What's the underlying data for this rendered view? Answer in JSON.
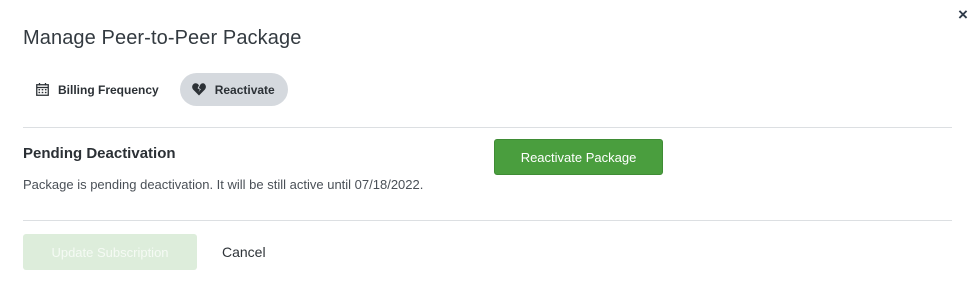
{
  "modal": {
    "title": "Manage Peer-to-Peer Package",
    "close_label": "×"
  },
  "tabs": [
    {
      "label": "Billing Frequency",
      "icon": "calendar-icon",
      "active": false
    },
    {
      "label": "Reactivate",
      "icon": "broken-heart-icon",
      "active": true
    }
  ],
  "section": {
    "heading": "Pending Deactivation",
    "description": "Package is pending deactivation. It will be still active until 07/18/2022.",
    "action_label": "Reactivate Package"
  },
  "footer": {
    "update_label": "Update Subscription",
    "cancel_label": "Cancel"
  },
  "colors": {
    "accent_green": "#4a9e3e",
    "disabled_green": "#ddeddb",
    "active_tab_bg": "#d5d9de"
  }
}
